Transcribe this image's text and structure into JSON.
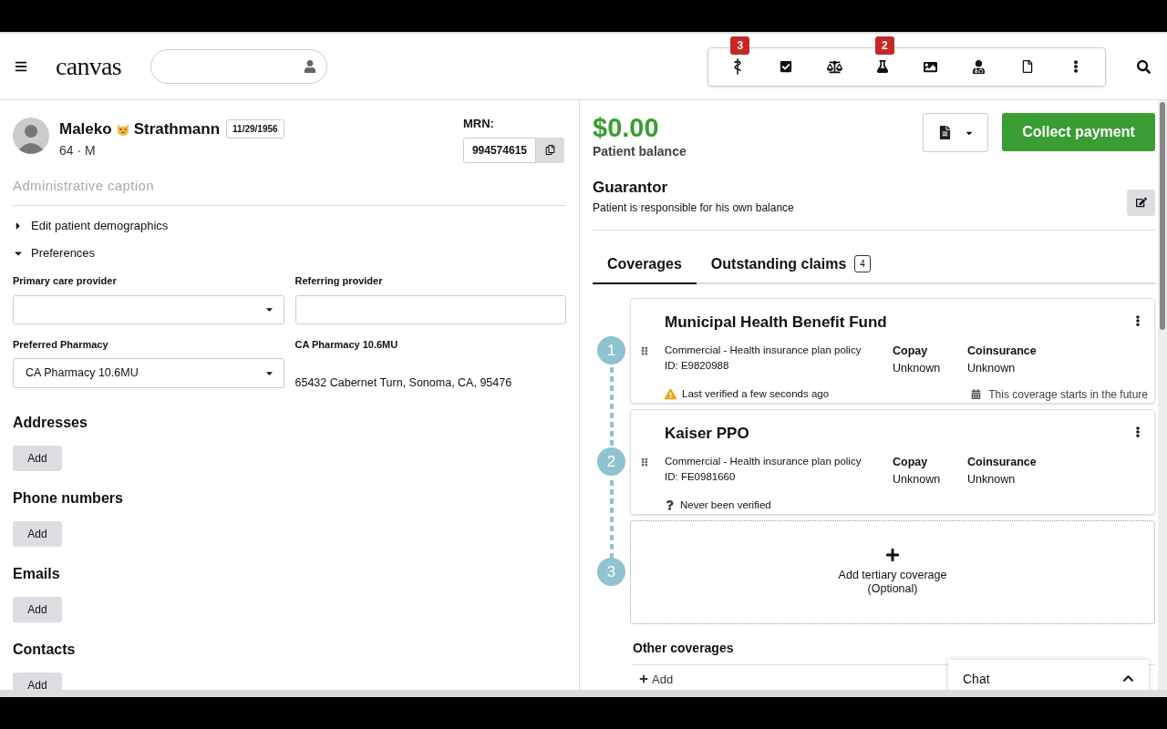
{
  "header": {
    "logo": "canvas",
    "toolbar": [
      {
        "kind": "caduceus",
        "badge": "3"
      },
      {
        "kind": "tasks"
      },
      {
        "kind": "scales"
      },
      {
        "kind": "flask",
        "badge": "2"
      },
      {
        "kind": "image"
      },
      {
        "kind": "doctor"
      },
      {
        "kind": "file"
      },
      {
        "kind": "more"
      }
    ]
  },
  "patient": {
    "first_name": "Maleko",
    "last_name": "Strathmann",
    "dob": "11/29/1956",
    "age_sex": "64 · M",
    "mrn_label": "MRN:",
    "mrn": "994574615",
    "caption_placeholder": "Administrative caption"
  },
  "disclosures": [
    {
      "label": "Edit patient demographics",
      "expanded": false
    },
    {
      "label": "Preferences",
      "expanded": true
    }
  ],
  "preferences": {
    "primary_care_label": "Primary care provider",
    "referring_label": "Referring provider",
    "pharmacy_label": "Preferred Pharmacy",
    "pharmacy_value": "CA Pharmacy 10.6MU",
    "pharmacy_name": "CA Pharmacy 10.6MU",
    "pharmacy_address": "65432 Cabernet Turn, Sonoma, CA, 95476"
  },
  "contact_sections": [
    {
      "title": "Addresses",
      "button": "Add"
    },
    {
      "title": "Phone numbers",
      "button": "Add"
    },
    {
      "title": "Emails",
      "button": "Add"
    },
    {
      "title": "Contacts",
      "button": "Add"
    }
  ],
  "billing": {
    "balance": "$0.00",
    "balance_label": "Patient balance",
    "collect_button": "Collect payment",
    "guarantor_title": "Guarantor",
    "guarantor_text": "Patient is responsible for his own balance"
  },
  "tabs": [
    {
      "label": "Coverages",
      "selected": true
    },
    {
      "label": "Outstanding claims",
      "selected": false,
      "count": "4"
    }
  ],
  "coverages": [
    {
      "step": "1",
      "name": "Municipal Health Benefit Fund",
      "type": "Commercial - Health insurance plan policy",
      "id": "ID: E9820988",
      "copay_label": "Copay",
      "copay": "Unknown",
      "coinsurance_label": "Coinsurance",
      "coinsurance": "Unknown",
      "status": {
        "kind": "warning",
        "text": "Last verified a few seconds ago"
      },
      "note": "This coverage starts in the future"
    },
    {
      "step": "2",
      "name": "Kaiser PPO",
      "type": "Commercial - Health insurance plan policy",
      "id": "ID: FE0981660",
      "copay_label": "Copay",
      "copay": "Unknown",
      "coinsurance_label": "Coinsurance",
      "coinsurance": "Unknown",
      "status": {
        "kind": "unknown",
        "text": "Never been verified"
      }
    }
  ],
  "add_slot": {
    "step": "3",
    "title": "Add tertiary coverage",
    "subtitle": "(Optional)"
  },
  "other_coverages": {
    "title": "Other coverages",
    "button": "Add"
  },
  "chat": {
    "label": "Chat"
  }
}
